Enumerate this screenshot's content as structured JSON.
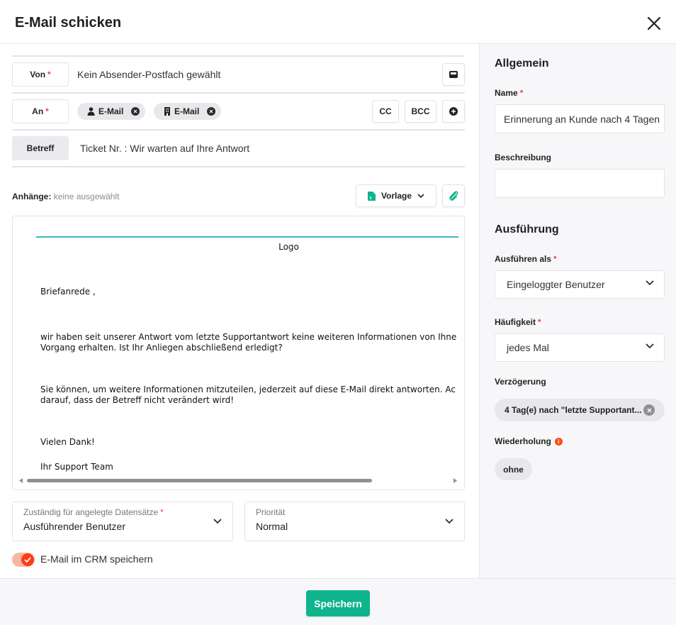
{
  "header": {
    "title": "E-Mail schicken"
  },
  "compose": {
    "from_label": "Von",
    "from_value": "Kein Absender-Postfach gewählt",
    "to_label": "An",
    "recipients": [
      {
        "label": "E-Mail",
        "icon": "person-icon"
      },
      {
        "label": "E-Mail",
        "icon": "building-icon"
      }
    ],
    "cc_label": "CC",
    "bcc_label": "BCC",
    "subject_label": "Betreff",
    "subject_value": "Ticket Nr. : Wir warten auf Ihre Antwort",
    "attachments_label": "Anhänge:",
    "attachments_value": "keine ausgewählt",
    "template_label": "Vorlage"
  },
  "editor": {
    "logo": "Logo",
    "paragraphs": [
      "Briefanrede ,",
      "wir haben seit unserer Antwort vom letzte Supportantwort keine weiteren Informationen von Ihne",
      "Vorgang erhalten. Ist Ihr Anliegen abschließend erledigt?",
      "Sie können, um weitere Informationen mitzuteilen, jederzeit auf diese E-Mail direkt antworten. Ac",
      "darauf, dass der Betreff nicht verändert wird!",
      "Vielen Dank!",
      "Ihr Support Team"
    ]
  },
  "fields": {
    "responsible_label": "Zuständig für angelegte Datensätze",
    "responsible_value": "Ausführender Benutzer",
    "priority_label": "Priorität",
    "priority_value": "Normal",
    "save_crm_label": "E-Mail im CRM speichern"
  },
  "sidebar": {
    "general_heading": "Allgemein",
    "name_label": "Name",
    "name_value": "Erinnerung an Kunde nach 4 Tagen",
    "description_label": "Beschreibung",
    "description_value": "",
    "execution_heading": "Ausführung",
    "run_as_label": "Ausführen als",
    "run_as_value": "Eingeloggter Benutzer",
    "frequency_label": "Häufigkeit",
    "frequency_value": "jedes Mal",
    "delay_label": "Verzögerung",
    "delay_value": "4 Tag(e) nach \"letzte Supportant...",
    "repeat_label": "Wiederholung",
    "repeat_value": "ohne"
  },
  "footer": {
    "save_label": "Speichern"
  },
  "colors": {
    "accent": "#10b48c",
    "required": "#e5484d",
    "toggle": "#ff3c12",
    "divider": "#3bb5c4"
  }
}
